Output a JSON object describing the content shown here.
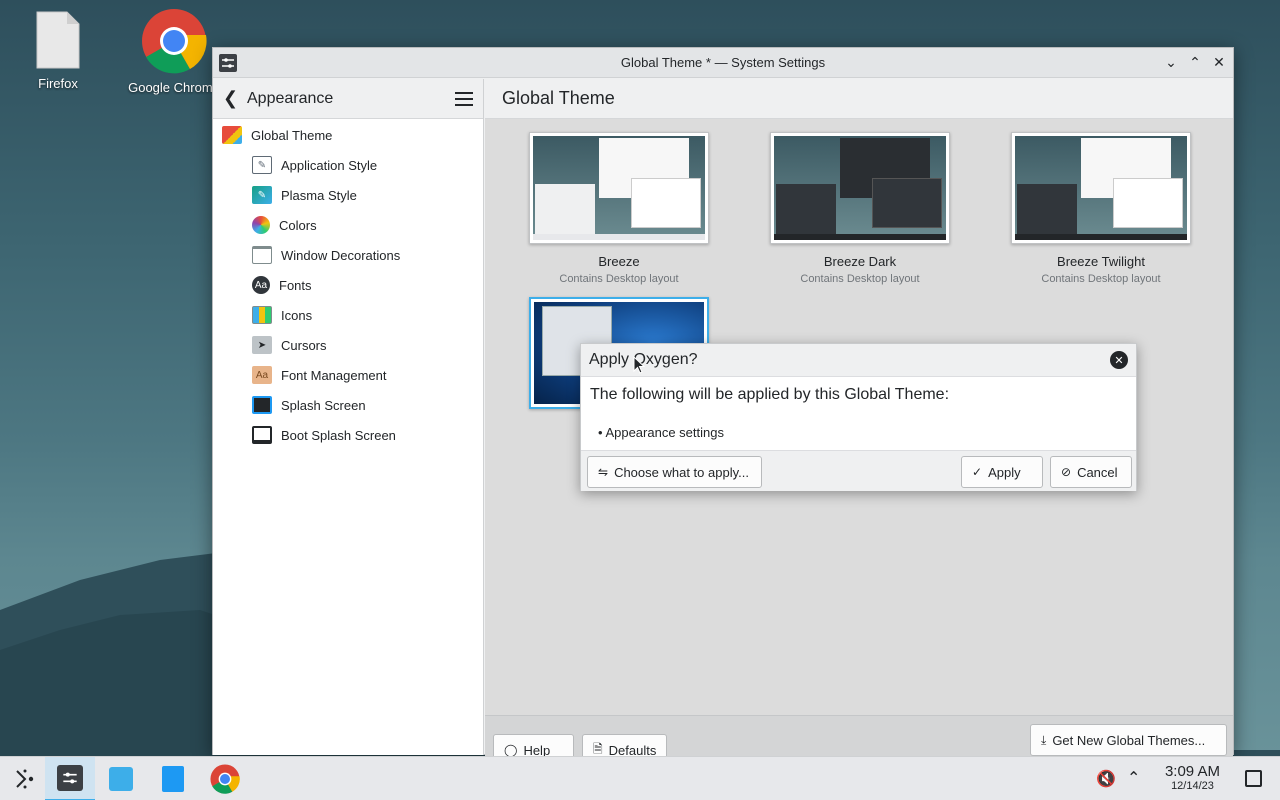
{
  "desktop": {
    "icons": [
      {
        "label": "Firefox",
        "icon": "file-icon"
      },
      {
        "label": "Google Chrome",
        "icon": "chrome-icon"
      }
    ]
  },
  "window": {
    "title": "Global Theme * — System Settings",
    "sidebar": {
      "heading": "Appearance",
      "items": [
        {
          "label": "Global Theme",
          "icon": "global-theme-icon",
          "color": "#c0392b",
          "level": "top"
        },
        {
          "label": "Application Style",
          "icon": "application-style-icon",
          "color": "#5f6a75",
          "level": "sub"
        },
        {
          "label": "Plasma Style",
          "icon": "plasma-style-icon",
          "color": "#16a085",
          "level": "sub"
        },
        {
          "label": "Colors",
          "icon": "colors-icon",
          "color": "#8e44ad",
          "level": "sub"
        },
        {
          "label": "Window Decorations",
          "icon": "window-decorations-icon",
          "color": "#ffffff",
          "level": "sub"
        },
        {
          "label": "Fonts",
          "icon": "fonts-icon",
          "color": "#31363b",
          "level": "sub"
        },
        {
          "label": "Icons",
          "icon": "icons-icon",
          "color": "#3daee9",
          "level": "sub"
        },
        {
          "label": "Cursors",
          "icon": "cursors-icon",
          "color": "#7f8c8d",
          "level": "sub"
        },
        {
          "label": "Font Management",
          "icon": "font-management-icon",
          "color": "#d8a277",
          "level": "sub"
        },
        {
          "label": "Splash Screen",
          "icon": "splash-screen-icon",
          "color": "#1d99f3",
          "level": "sub"
        },
        {
          "label": "Boot Splash Screen",
          "icon": "boot-splash-screen-icon",
          "color": "#232629",
          "level": "sub"
        }
      ]
    },
    "content": {
      "heading": "Global Theme",
      "themes": [
        {
          "name": "Breeze",
          "subtitle": "Contains Desktop layout",
          "variant": "light"
        },
        {
          "name": "Breeze Dark",
          "subtitle": "Contains Desktop layout",
          "variant": "dark"
        },
        {
          "name": "Breeze Twilight",
          "subtitle": "Contains Desktop layout",
          "variant": "twilight"
        },
        {
          "name": "",
          "subtitle": "",
          "variant": "oxygen"
        }
      ],
      "get_new_label": "Get New Global Themes..."
    },
    "footer": {
      "help_label": "Help",
      "defaults_label": "Defaults"
    }
  },
  "dialog": {
    "title": "Apply Oxygen?",
    "body": "The following will be applied by this Global Theme:",
    "items": [
      "• Appearance settings"
    ],
    "choose_label": "Choose what to apply...",
    "apply_label": "Apply",
    "cancel_label": "Cancel"
  },
  "taskbar": {
    "time": "3:09 AM",
    "date": "12/14/23",
    "accent": "#3daee9"
  }
}
